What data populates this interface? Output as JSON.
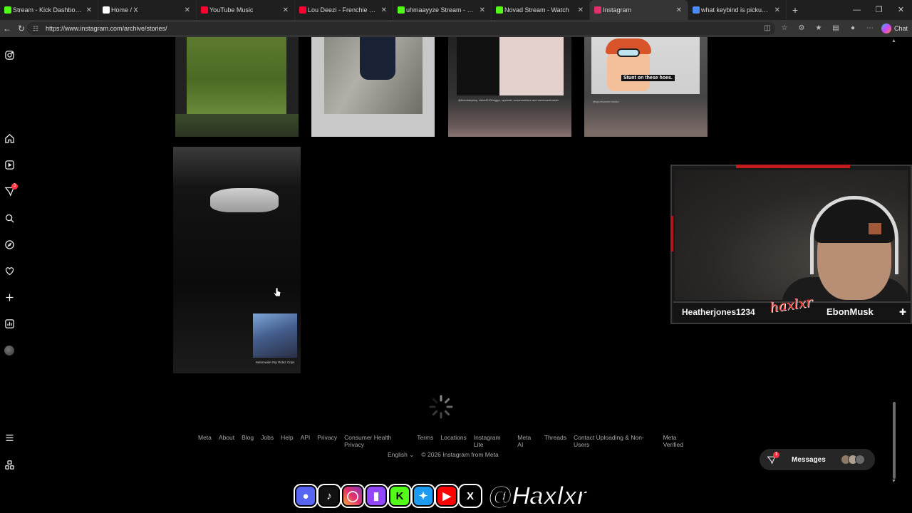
{
  "browser": {
    "tabs": [
      {
        "title": "Stream - Kick Dashboard",
        "color": "#53fc18"
      },
      {
        "title": "Home / X",
        "color": "#ffffff"
      },
      {
        "title": "YouTube Music",
        "color": "#ff0033"
      },
      {
        "title": "Lou Deezi - Frenchie (Officia",
        "color": "#ff0033"
      },
      {
        "title": "uhmaayyze Stream - Watch",
        "color": "#53fc18"
      },
      {
        "title": "Novad Stream - Watch",
        "color": "#53fc18"
      },
      {
        "title": "Instagram",
        "color": "#e1306c"
      },
      {
        "title": "what keybind is pickup in ru",
        "color": "#4c8bf5"
      }
    ],
    "url": "https://www.instagram.com/archive/stories/",
    "chat_label": "Chat"
  },
  "stories": {
    "tile3_caption": "@thandakydap, #steel2100nigga, rapbeatt, westcoastfacs and westcoastinsider",
    "tile4_caption": "Stunt on these hoes.",
    "tile4_source": "@sportsworld.media",
    "tile5_caption": "Nationwide Rip Ridaz Crips"
  },
  "sidebar": {
    "notifications_badge": "3"
  },
  "footer": {
    "links": [
      "Meta",
      "About",
      "Blog",
      "Jobs",
      "Help",
      "API",
      "Privacy",
      "Consumer Health Privacy",
      "Terms",
      "Locations",
      "Instagram Lite",
      "Meta AI",
      "Threads",
      "Contact Uploading & Non-Users",
      "Meta Verified"
    ],
    "language": "English",
    "copyright": "© 2026 Instagram from Meta"
  },
  "messages": {
    "label": "Messages",
    "badge": "1"
  },
  "overlay": {
    "viewer_handle": "Heatherjones1234",
    "logo_text": "haxlxr",
    "channel_name": "EbonMusk",
    "social_handle": "@Haxlxr"
  }
}
